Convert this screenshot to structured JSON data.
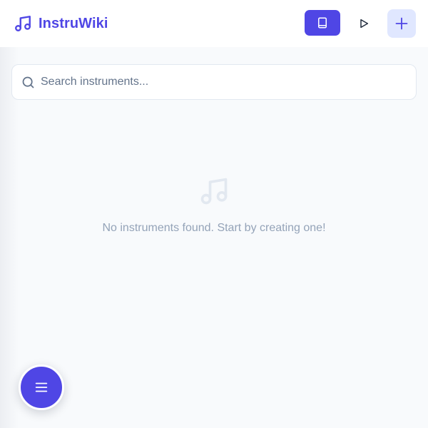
{
  "app": {
    "title": "InstruWiki",
    "logo_icon": "music-note-icon",
    "accent_color": "#4f46e5"
  },
  "toolbar": {
    "wiki_button_icon": "book-icon",
    "play_button_icon": "play-icon",
    "add_button_icon": "plus-icon"
  },
  "search": {
    "placeholder": "Search instruments...",
    "value": "",
    "icon": "search-icon"
  },
  "empty_state": {
    "icon": "music-note-icon",
    "message": "No instruments found. Start by creating one!"
  },
  "fab": {
    "icon": "menu-icon"
  }
}
